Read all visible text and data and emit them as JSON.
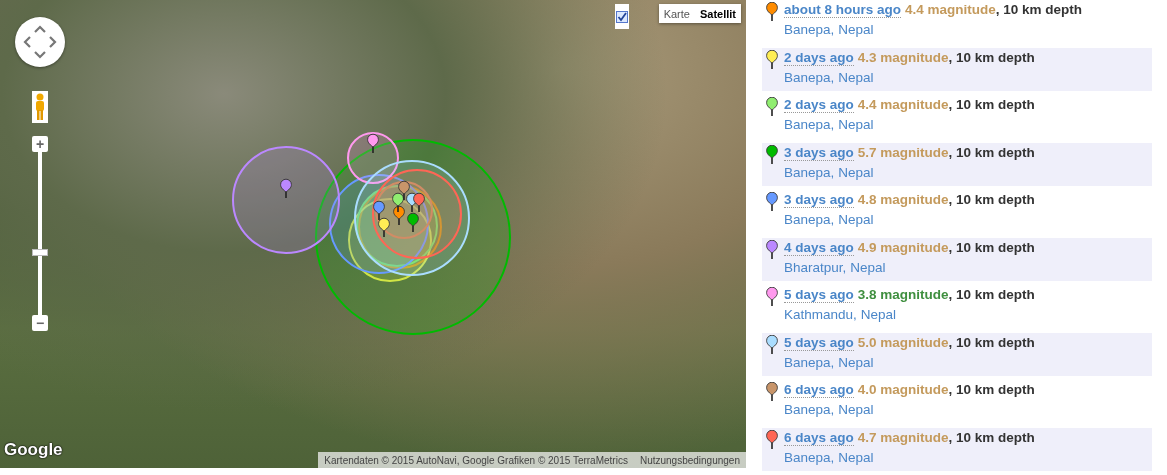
{
  "map": {
    "map_types": [
      {
        "label": "Karte",
        "selected": false
      },
      {
        "label": "Satellit",
        "selected": true
      }
    ],
    "overlay_checkbox": {
      "checked": true
    },
    "zoom_control": {
      "zoom_in": "+",
      "zoom_out": "−",
      "level": 0.39
    },
    "logo": "Google",
    "attribution": "Kartendaten © 2015 AutoNavi, Google Grafiken © 2015 TerraMetrics",
    "terms_link": "Nutzungsbedingungen"
  },
  "earthquakes": [
    {
      "time": "about 8 hours ago",
      "magnitude": {
        "text": "4.4 magnitude",
        "color": "#c49a5c"
      },
      "depth": ", 10 km depth",
      "place": "Banepa,",
      "country": "Nepal",
      "color": "#ff8c00"
    },
    {
      "time": "2 days ago",
      "magnitude": {
        "text": "4.3 magnitude",
        "color": "#c49a5c"
      },
      "depth": ", 10 km depth",
      "place": "Banepa,",
      "country": "Nepal",
      "color": "#ffee55"
    },
    {
      "time": "2 days ago",
      "magnitude": {
        "text": "4.4 magnitude",
        "color": "#c49a5c"
      },
      "depth": ", 10 km depth",
      "place": "Banepa,",
      "country": "Nepal",
      "color": "#90ee70"
    },
    {
      "time": "3 days ago",
      "magnitude": {
        "text": "5.7 magnitude",
        "color": "#c49a5c"
      },
      "depth": ", 10 km depth",
      "place": "Banepa,",
      "country": "Nepal",
      "color": "#00bb00"
    },
    {
      "time": "3 days ago",
      "magnitude": {
        "text": "4.8 magnitude",
        "color": "#c49a5c"
      },
      "depth": ", 10 km depth",
      "place": "Banepa,",
      "country": "Nepal",
      "color": "#6699ff"
    },
    {
      "time": "4 days ago",
      "magnitude": {
        "text": "4.9 magnitude",
        "color": "#c49a5c"
      },
      "depth": ", 10 km depth",
      "place": "Bharatpur,",
      "country": "Nepal",
      "color": "#bb88ff"
    },
    {
      "time": "5 days ago",
      "magnitude": {
        "text": "3.8 magnitude",
        "color": "#3f8f3f"
      },
      "depth": ", 10 km depth",
      "place": "Kathmandu,",
      "country": "Nepal",
      "color": "#ff99ee"
    },
    {
      "time": "5 days ago",
      "magnitude": {
        "text": "5.0 magnitude",
        "color": "#c49a5c"
      },
      "depth": ", 10 km depth",
      "place": "Banepa,",
      "country": "Nepal",
      "color": "#aaddff"
    },
    {
      "time": "6 days ago",
      "magnitude": {
        "text": "4.0 magnitude",
        "color": "#c49a5c"
      },
      "depth": ", 10 km depth",
      "place": "Banepa,",
      "country": "Nepal",
      "color": "#c8956a"
    },
    {
      "time": "6 days ago",
      "magnitude": {
        "text": "4.7 magnitude",
        "color": "#c49a5c"
      },
      "depth": ", 10 km depth",
      "place": "Banepa,",
      "country": "Nepal",
      "color": "#ff6655"
    }
  ]
}
